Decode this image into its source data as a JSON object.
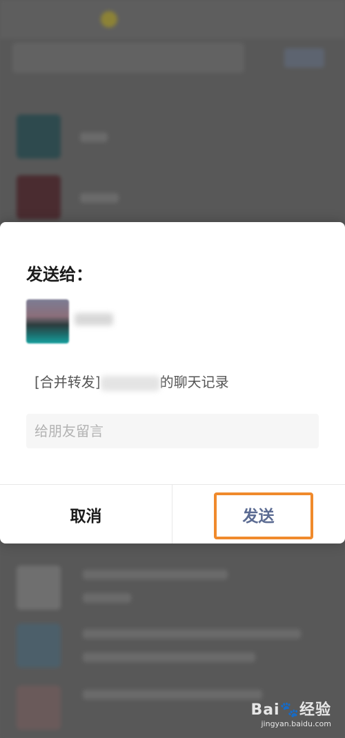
{
  "dialog": {
    "title": "发送给：",
    "message_prefix": "[合并转发]",
    "message_suffix": "的聊天记录",
    "input_placeholder": "给朋友留言",
    "cancel_label": "取消",
    "send_label": "发送"
  },
  "watermark": {
    "logo": "Bai🐾经验",
    "url": "jingyan.baidu.com"
  },
  "colors": {
    "send_text": "#5b6b92",
    "highlight_border": "#f08a2c"
  }
}
